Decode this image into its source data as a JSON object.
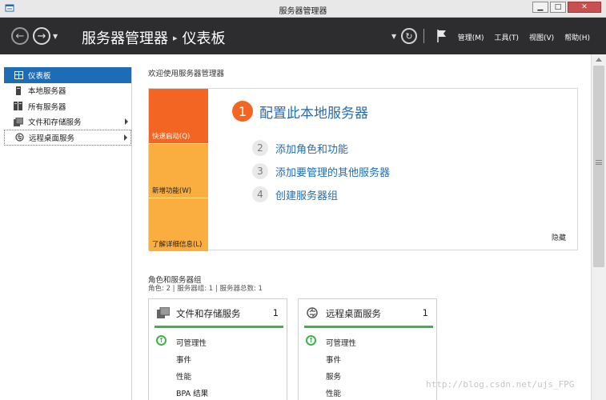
{
  "window": {
    "title": "服务器管理器"
  },
  "window_buttons": {
    "minimize": "▁",
    "maximize": "□",
    "close": "✕"
  },
  "nav": {
    "breadcrumb_root": "服务器管理器",
    "breadcrumb_sep": "▸",
    "breadcrumb_current": "仪表板",
    "menus": [
      "管理(M)",
      "工具(T)",
      "视图(V)",
      "帮助(H)"
    ]
  },
  "sidebar": {
    "items": [
      {
        "label": "仪表板",
        "icon": "dashboard-icon"
      },
      {
        "label": "本地服务器",
        "icon": "server-icon"
      },
      {
        "label": "所有服务器",
        "icon": "servers-icon"
      },
      {
        "label": "文件和存储服务",
        "icon": "file-storage-icon"
      },
      {
        "label": "远程桌面服务",
        "icon": "remote-desktop-icon"
      }
    ]
  },
  "main": {
    "welcome_heading": "欢迎使用服务器管理器",
    "tiles": [
      "快速启动(Q)",
      "新增功能(W)",
      "了解详细信息(L)"
    ],
    "steps": [
      {
        "num": "1",
        "label": "配置此本地服务器"
      },
      {
        "num": "2",
        "label": "添加角色和功能"
      },
      {
        "num": "3",
        "label": "添加要管理的其他服务器"
      },
      {
        "num": "4",
        "label": "创建服务器组"
      }
    ],
    "hide_label": "隐藏",
    "roles_heading": "角色和服务器组",
    "roles_subheading": "角色: 2 | 服务器组: 1 | 服务器总数: 1",
    "cards": [
      {
        "title": "文件和存储服务",
        "count": "1",
        "rows": [
          "可管理性",
          "事件",
          "性能",
          "BPA 结果"
        ]
      },
      {
        "title": "远程桌面服务",
        "count": "1",
        "rows": [
          "可管理性",
          "事件",
          "服务",
          "性能"
        ]
      }
    ]
  },
  "watermark": "http://blog.csdn.net/ujs_FPG",
  "colors": {
    "accent": "#1c6db6",
    "orange": "#f26522",
    "tile": "#fbae40",
    "status_ok": "#3bb54a",
    "header_bg": "#2d2d30"
  }
}
